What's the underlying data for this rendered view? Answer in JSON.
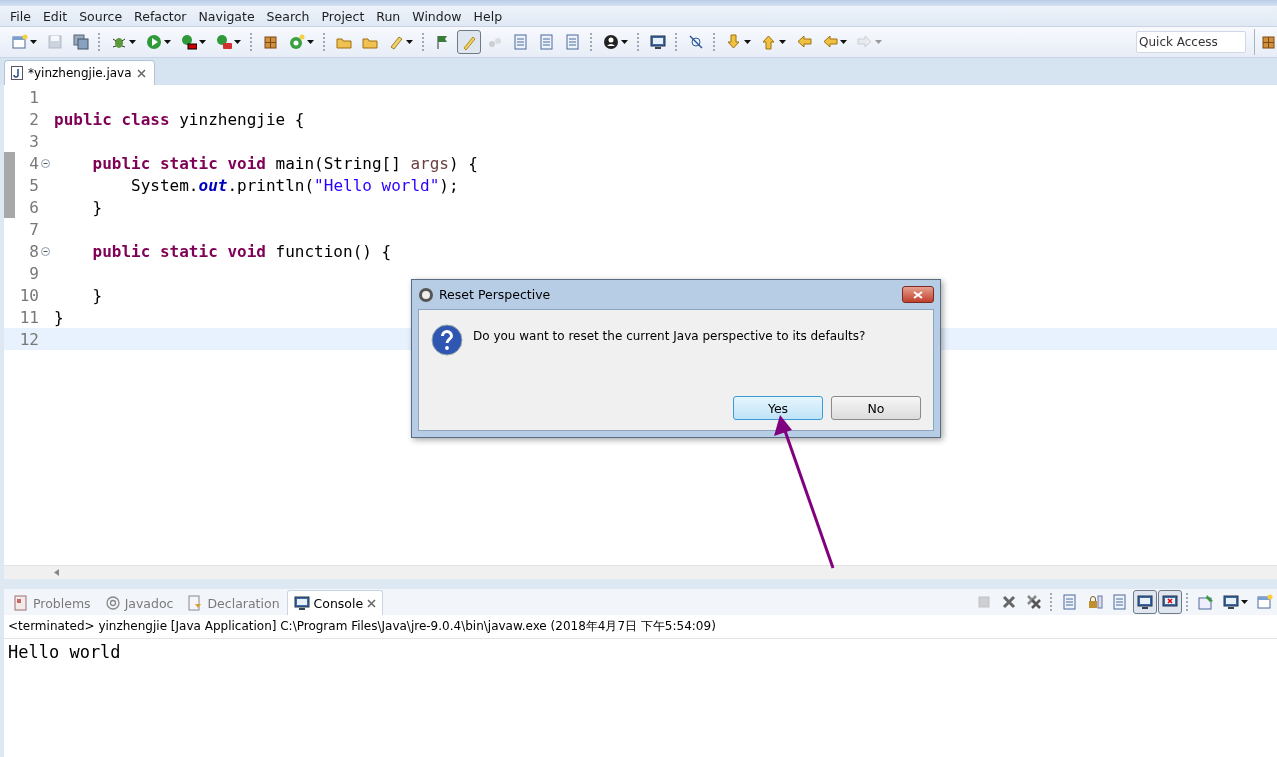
{
  "menu": [
    "File",
    "Edit",
    "Source",
    "Refactor",
    "Navigate",
    "Search",
    "Project",
    "Run",
    "Window",
    "Help"
  ],
  "toolbar": [
    {
      "kind": "new-doc",
      "caret": true,
      "pressed": false,
      "disabled": false
    },
    {
      "kind": "disk",
      "caret": false,
      "pressed": false,
      "disabled": true
    },
    {
      "kind": "disks",
      "caret": false,
      "pressed": false,
      "disabled": false
    },
    {
      "kind": "sep"
    },
    {
      "kind": "bug",
      "caret": true,
      "pressed": false,
      "disabled": false
    },
    {
      "kind": "play",
      "caret": true,
      "pressed": false,
      "disabled": false
    },
    {
      "kind": "play-flag",
      "caret": true,
      "pressed": false,
      "disabled": false
    },
    {
      "kind": "play-case",
      "caret": true,
      "pressed": false,
      "disabled": false
    },
    {
      "kind": "sep"
    },
    {
      "kind": "grid",
      "caret": false,
      "pressed": false,
      "disabled": false
    },
    {
      "kind": "circle-plus",
      "caret": true,
      "pressed": false,
      "disabled": false
    },
    {
      "kind": "sep"
    },
    {
      "kind": "folder",
      "caret": false,
      "pressed": false,
      "disabled": false
    },
    {
      "kind": "folder",
      "caret": false,
      "pressed": false,
      "disabled": false
    },
    {
      "kind": "pen",
      "caret": true,
      "pressed": false,
      "disabled": false
    },
    {
      "kind": "sep"
    },
    {
      "kind": "flag",
      "caret": false,
      "pressed": false,
      "disabled": false
    },
    {
      "kind": "brush",
      "caret": false,
      "pressed": true,
      "disabled": false
    },
    {
      "kind": "dots",
      "caret": false,
      "pressed": false,
      "disabled": true
    },
    {
      "kind": "page",
      "caret": false,
      "pressed": false,
      "disabled": false
    },
    {
      "kind": "page",
      "caret": false,
      "pressed": false,
      "disabled": false
    },
    {
      "kind": "page",
      "caret": false,
      "pressed": false,
      "disabled": false
    },
    {
      "kind": "sep"
    },
    {
      "kind": "person",
      "caret": true,
      "pressed": false,
      "disabled": false
    },
    {
      "kind": "sep"
    },
    {
      "kind": "monitor",
      "caret": false,
      "pressed": false,
      "disabled": false
    },
    {
      "kind": "sep"
    },
    {
      "kind": "slash",
      "caret": false,
      "pressed": false,
      "disabled": false
    },
    {
      "kind": "sep"
    },
    {
      "kind": "arrow-down",
      "caret": true,
      "pressed": false,
      "disabled": false
    },
    {
      "kind": "arrow-up",
      "caret": true,
      "pressed": false,
      "disabled": false
    },
    {
      "kind": "arrow-left",
      "caret": false,
      "pressed": false,
      "disabled": false
    },
    {
      "kind": "arrow-left",
      "caret": true,
      "pressed": false,
      "disabled": false
    },
    {
      "kind": "arrow-right",
      "caret": true,
      "pressed": false,
      "disabled": true
    }
  ],
  "quick_access": {
    "placeholder": "Quick Access"
  },
  "editor": {
    "tabs": [
      {
        "label": "*yinzhengjie.java",
        "selected": true
      }
    ],
    "lines": [
      {
        "number": "1",
        "fold": false,
        "changed": false,
        "current": false
      },
      {
        "number": "2",
        "fold": false,
        "changed": false,
        "current": false,
        "tokens": [
          {
            "kind": "keyword",
            "text": "public class "
          },
          {
            "kind": "plain",
            "text": "yinzhengjie {"
          }
        ]
      },
      {
        "number": "3",
        "fold": false,
        "changed": false,
        "current": false
      },
      {
        "number": "4",
        "fold": true,
        "changed": true,
        "current": false,
        "tokens": [
          {
            "kind": "keyword",
            "text": "    public static void "
          },
          {
            "kind": "plain",
            "text": "main(String[] "
          },
          {
            "kind": "param",
            "text": "args"
          },
          {
            "kind": "plain",
            "text": ") {"
          }
        ]
      },
      {
        "number": "5",
        "fold": false,
        "changed": true,
        "current": false,
        "tokens": [
          {
            "kind": "plain",
            "text": "        System."
          },
          {
            "kind": "field",
            "text": "out"
          },
          {
            "kind": "plain",
            "text": ".println("
          },
          {
            "kind": "string",
            "text": "\"Hello world\""
          },
          {
            "kind": "plain",
            "text": ");"
          }
        ]
      },
      {
        "number": "6",
        "fold": false,
        "changed": true,
        "current": false,
        "tokens": [
          {
            "kind": "plain",
            "text": "    }"
          }
        ]
      },
      {
        "number": "7",
        "fold": false,
        "changed": false,
        "current": false
      },
      {
        "number": "8",
        "fold": true,
        "changed": false,
        "current": false,
        "tokens": [
          {
            "kind": "keyword",
            "text": "    public static void "
          },
          {
            "kind": "plain",
            "text": "function() {"
          }
        ]
      },
      {
        "number": "9",
        "fold": false,
        "changed": false,
        "current": false
      },
      {
        "number": "10",
        "fold": false,
        "changed": false,
        "current": false,
        "tokens": [
          {
            "kind": "plain",
            "text": "    }"
          }
        ]
      },
      {
        "number": "11",
        "fold": false,
        "changed": false,
        "current": false,
        "tokens": [
          {
            "kind": "plain",
            "text": "}"
          }
        ]
      },
      {
        "number": "12",
        "fold": false,
        "changed": false,
        "current": true
      }
    ]
  },
  "bottom_panel": {
    "tabs": [
      {
        "label": "Problems",
        "kind": "problems",
        "selected": false
      },
      {
        "label": "Javadoc",
        "kind": "at",
        "selected": false
      },
      {
        "label": "Declaration",
        "kind": "declaration",
        "selected": false
      },
      {
        "label": "Console",
        "kind": "monitor",
        "selected": true
      }
    ],
    "toolbar": [
      {
        "kind": "stop",
        "caret": false,
        "pressed": false,
        "disabled": true
      },
      {
        "kind": "x",
        "caret": false,
        "pressed": false,
        "disabled": false
      },
      {
        "kind": "xx",
        "caret": false,
        "pressed": false,
        "disabled": false
      },
      {
        "kind": "sep"
      },
      {
        "kind": "page",
        "caret": false,
        "pressed": false,
        "disabled": false
      },
      {
        "kind": "lock",
        "caret": false,
        "pressed": false,
        "disabled": false
      },
      {
        "kind": "page",
        "caret": false,
        "pressed": false,
        "disabled": false
      },
      {
        "kind": "monitor",
        "caret": false,
        "pressed": true,
        "disabled": false
      },
      {
        "kind": "monitor-x",
        "caret": false,
        "pressed": true,
        "disabled": false
      },
      {
        "kind": "sep"
      },
      {
        "kind": "pin",
        "caret": false,
        "pressed": false,
        "disabled": false
      },
      {
        "kind": "monitor",
        "caret": true,
        "pressed": false,
        "disabled": false
      },
      {
        "kind": "new-doc",
        "caret": false,
        "pressed": false,
        "disabled": false
      }
    ],
    "console_header": "<terminated> yinzhengjie [Java Application] C:\\Program Files\\Java\\jre-9.0.4\\bin\\javaw.exe (2018年4月7日 下午5:54:09)",
    "output": [
      "Hello world"
    ]
  },
  "dialog": {
    "title": "Reset Perspective",
    "message": "Do you want to reset the current Java perspective to its defaults?",
    "buttons": [
      {
        "label": "Yes",
        "default": true
      },
      {
        "label": "No",
        "default": false
      }
    ]
  }
}
